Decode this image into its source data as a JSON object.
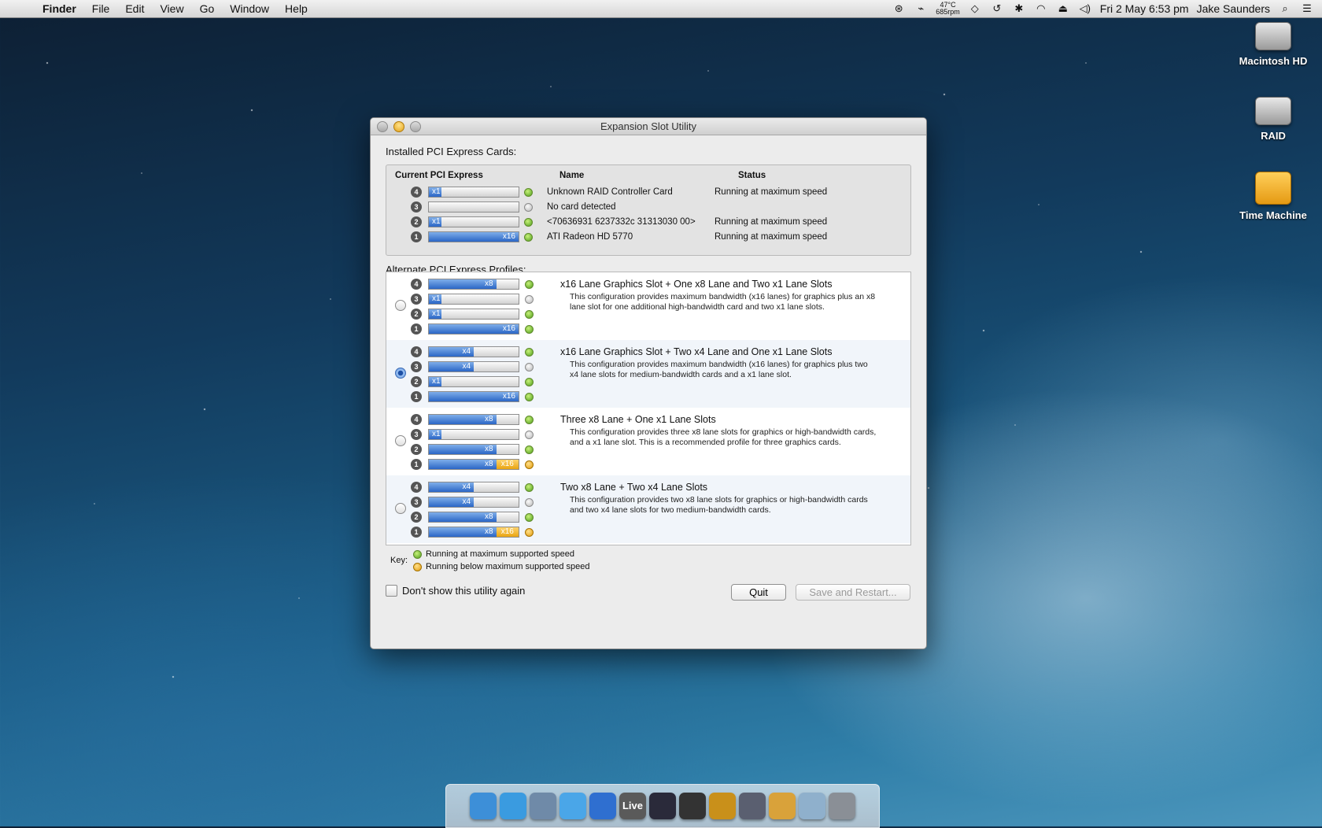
{
  "menubar": {
    "app": "Finder",
    "items": [
      "File",
      "Edit",
      "View",
      "Go",
      "Window",
      "Help"
    ],
    "temp_line1": "47°C",
    "temp_line2": "685rpm",
    "datetime": "Fri 2 May  6:53 pm",
    "user": "Jake Saunders"
  },
  "desktop": {
    "icons": [
      "Macintosh HD",
      "RAID",
      "Time Machine"
    ]
  },
  "window": {
    "title": "Expansion Slot Utility",
    "installed_label": "Installed PCI Express Cards:",
    "headers": {
      "current": "Current PCI Express",
      "name": "Name",
      "status": "Status"
    },
    "installed": [
      {
        "slot": "4",
        "lane": "x1",
        "fill": 0.14,
        "status_color": "green",
        "name": "Unknown RAID Controller Card",
        "status": "Running at maximum speed"
      },
      {
        "slot": "3",
        "lane": "",
        "fill": 0,
        "status_color": "grey",
        "name": "No card detected",
        "status": ""
      },
      {
        "slot": "2",
        "lane": "x1",
        "fill": 0.14,
        "status_color": "green",
        "name": "<70636931 6237332c 31313030 00>",
        "status": "Running at maximum speed"
      },
      {
        "slot": "1",
        "lane": "x16",
        "fill": 1.0,
        "status_color": "green",
        "name": "ATI Radeon HD 5770",
        "status": "Running at maximum speed"
      }
    ],
    "alternate_label": "Alternate PCI Express Profiles:",
    "profiles": [
      {
        "selected": false,
        "title": "x16 Lane Graphics Slot + One x8 Lane and Two x1 Lane Slots",
        "description": "This configuration provides maximum bandwidth (x16 lanes) for graphics plus an x8 lane slot for one additional high-bandwidth card and two x1 lane slots.",
        "slots": [
          {
            "slot": "4",
            "lane": "x8",
            "fill": 0.75,
            "dot": "green"
          },
          {
            "slot": "3",
            "lane": "x1",
            "fill": 0.14,
            "dot": "grey"
          },
          {
            "slot": "2",
            "lane": "x1",
            "fill": 0.14,
            "dot": "green"
          },
          {
            "slot": "1",
            "lane": "x16",
            "fill": 1.0,
            "dot": "green"
          }
        ]
      },
      {
        "selected": true,
        "title": "x16 Lane Graphics Slot + Two x4 Lane and One x1 Lane Slots",
        "description": "This configuration provides maximum bandwidth (x16 lanes) for graphics plus two x4 lane slots for medium-bandwidth cards and a x1 lane slot.",
        "slots": [
          {
            "slot": "4",
            "lane": "x4",
            "fill": 0.5,
            "dot": "green"
          },
          {
            "slot": "3",
            "lane": "x4",
            "fill": 0.5,
            "dot": "grey"
          },
          {
            "slot": "2",
            "lane": "x1",
            "fill": 0.14,
            "dot": "green"
          },
          {
            "slot": "1",
            "lane": "x16",
            "fill": 1.0,
            "dot": "green"
          }
        ]
      },
      {
        "selected": false,
        "title": "Three x8 Lane + One x1 Lane Slots",
        "description": "This configuration provides three x8 lane slots for graphics or high-bandwidth cards, and a x1 lane slot.  This is a recommended profile for three graphics cards.",
        "slots": [
          {
            "slot": "4",
            "lane": "x8",
            "fill": 0.75,
            "dot": "green"
          },
          {
            "slot": "3",
            "lane": "x1",
            "fill": 0.14,
            "dot": "grey"
          },
          {
            "slot": "2",
            "lane": "x8",
            "fill": 0.75,
            "dot": "green"
          },
          {
            "slot": "1",
            "lane": "x8",
            "fill": 0.75,
            "dot": "orange",
            "warn": "x16"
          }
        ]
      },
      {
        "selected": false,
        "title": "Two x8 Lane + Two x4 Lane Slots",
        "description": "This configuration provides two x8 lane slots for graphics or high-bandwidth cards and two x4 lane slots for two medium-bandwidth cards.",
        "slots": [
          {
            "slot": "4",
            "lane": "x4",
            "fill": 0.5,
            "dot": "green"
          },
          {
            "slot": "3",
            "lane": "x4",
            "fill": 0.5,
            "dot": "grey"
          },
          {
            "slot": "2",
            "lane": "x8",
            "fill": 0.75,
            "dot": "green"
          },
          {
            "slot": "1",
            "lane": "x8",
            "fill": 0.75,
            "dot": "orange",
            "warn": "x16"
          }
        ]
      }
    ],
    "key_label": "Key:",
    "key_green": "Running at maximum supported speed",
    "key_orange": "Running below maximum supported speed",
    "dont_show": "Don't show this utility again",
    "quit": "Quit",
    "save_restart": "Save and Restart..."
  },
  "dock": {
    "apps": [
      "finder-icon",
      "safari-icon",
      "preview-icon",
      "messages-icon",
      "itunes-icon",
      "live-icon",
      "logic-icon",
      "aperture-icon",
      "iphoto-icon",
      "final-cut-icon",
      "pages-icon",
      "downloads-icon",
      "trash-icon"
    ],
    "live_label": "Live"
  },
  "colors": {
    "selected_row": "#f1f5fa",
    "lane_blue": "#2a66c6",
    "warn_orange": "#e8a412",
    "ok_green": "#4e9e1b"
  }
}
